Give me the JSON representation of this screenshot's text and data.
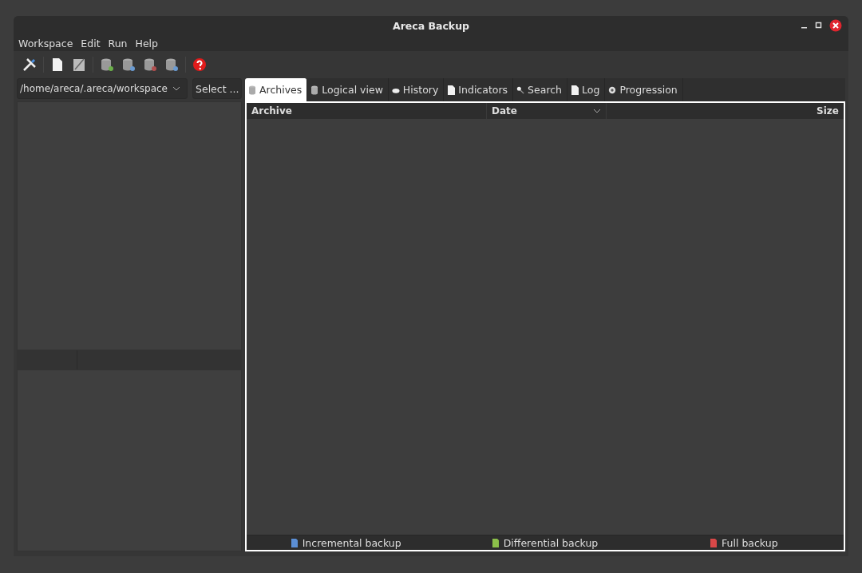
{
  "window": {
    "title": "Areca Backup"
  },
  "menu": [
    "Workspace",
    "Edit",
    "Run",
    "Help"
  ],
  "toolbar": [
    {
      "kind": "tools"
    },
    {
      "kind": "sep"
    },
    {
      "kind": "page"
    },
    {
      "kind": "edit"
    },
    {
      "kind": "sep"
    },
    {
      "kind": "db-add"
    },
    {
      "kind": "db-blue"
    },
    {
      "kind": "db-red"
    },
    {
      "kind": "db-blue"
    },
    {
      "kind": "sep"
    },
    {
      "kind": "help"
    }
  ],
  "workspace": {
    "path": "/home/areca/.areca/workspace",
    "select_button": "Select ..."
  },
  "tabs": [
    {
      "label": "Archives",
      "kind": "db",
      "selected": true
    },
    {
      "label": "Logical view",
      "kind": "db",
      "selected": false
    },
    {
      "label": "History",
      "kind": "cloud",
      "selected": false
    },
    {
      "label": "Indicators",
      "kind": "page",
      "selected": false
    },
    {
      "label": "Search",
      "kind": "search",
      "selected": false
    },
    {
      "label": "Log",
      "kind": "page",
      "selected": false
    },
    {
      "label": "Progression",
      "kind": "gear",
      "selected": false
    }
  ],
  "table": {
    "columns": [
      "Archive",
      "Date",
      "Size"
    ]
  },
  "legend": [
    {
      "label": "Incremental backup",
      "color": "#5b8fd6"
    },
    {
      "label": "Differential backup",
      "color": "#8cc04a"
    },
    {
      "label": "Full backup",
      "color": "#d94848"
    }
  ]
}
